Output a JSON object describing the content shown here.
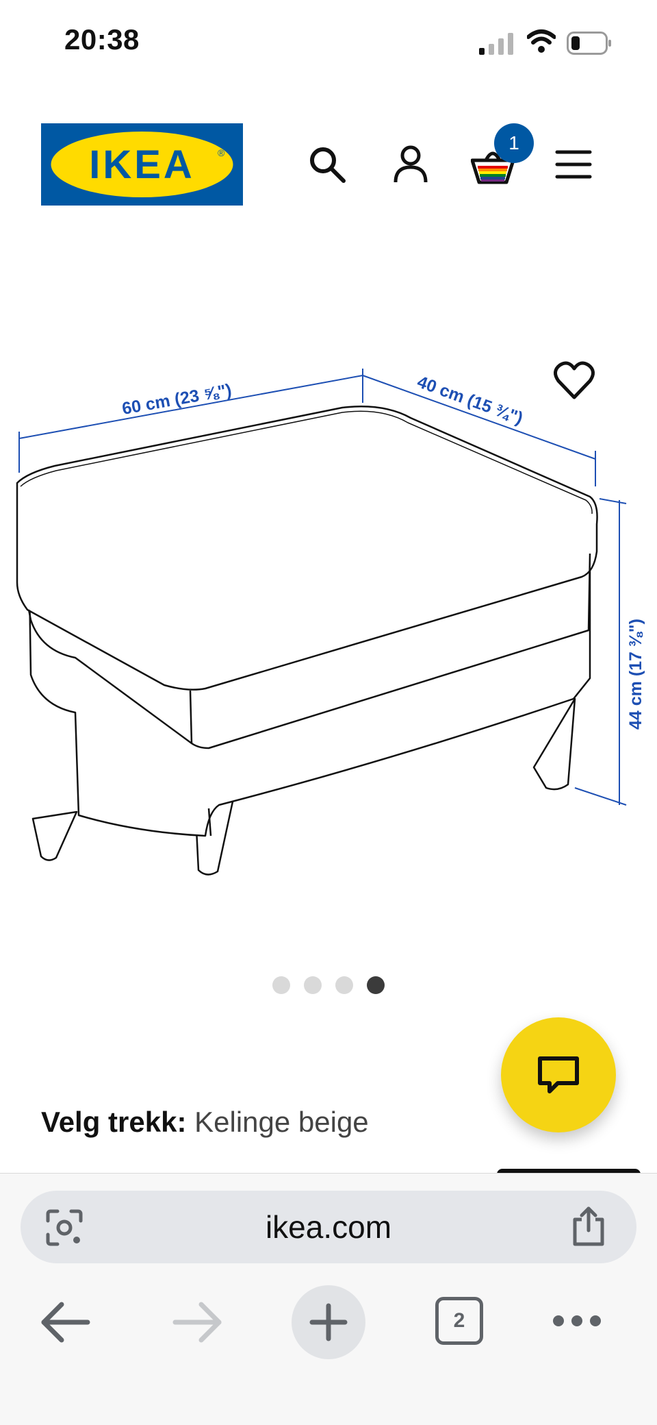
{
  "status_bar": {
    "time": "20:38"
  },
  "header": {
    "logo_text": "IKEA",
    "cart_count": "1",
    "icons": [
      "search-icon",
      "account-icon",
      "cart-icon",
      "menu-icon"
    ]
  },
  "product_image": {
    "dimension_width": "60 cm (23 ⅝\")",
    "dimension_depth": "40 cm (15 ¾\")",
    "dimension_height": "44 cm (17 ⅜\")",
    "carousel": {
      "count": 4,
      "active_index": 3
    }
  },
  "cover": {
    "label": "Velg trekk:",
    "value": "Kelinge beige"
  },
  "browser": {
    "url": "ikea.com",
    "tab_count": "2"
  },
  "colors": {
    "ikea_blue": "#0058a3",
    "ikea_yellow": "#ffdb00",
    "chat_yellow": "#f5d414",
    "dimension_blue": "#1d4fb3"
  }
}
